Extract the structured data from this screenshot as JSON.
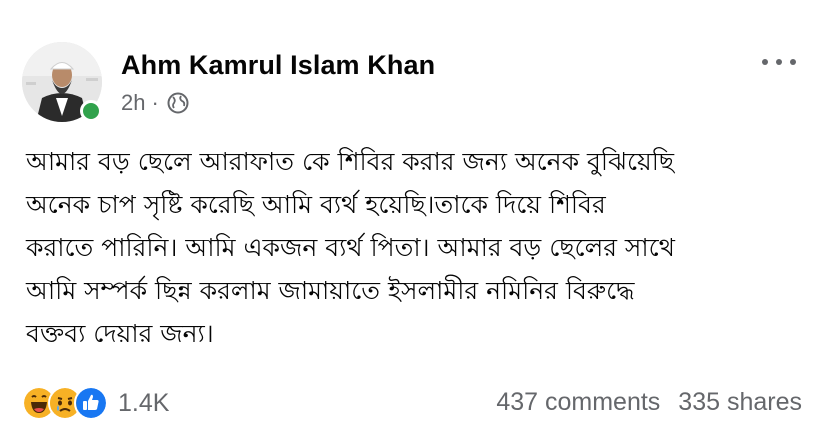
{
  "post": {
    "author": "Ahm Kamrul Islam Khan",
    "time": "2h",
    "separator": "·",
    "privacy_icon": "globe-icon",
    "more_icon": "ellipsis-icon",
    "text_lines": [
      "আমার বড় ছেলে আরাফাত কে শিবির করার জন্য অনেক বুঝিয়েছি",
      "অনেক চাপ সৃষ্টি করেছি আমি ব্যর্থ হয়েছি।তাকে দিয়ে শিবির",
      "করাতে পারিনি। আমি একজন ব্যর্থ পিতা। আমার বড় ছেলের সাথে",
      "আমি সম্পর্ক ছিন্ন করলাম জামায়াতে ইসলামীর নমিনির বিরুদ্ধে",
      "বক্তব্য দেয়ার জন্য।"
    ]
  },
  "footer": {
    "reaction_icons": [
      "haha-icon",
      "sad-icon",
      "like-icon"
    ],
    "reaction_count": "1.4K",
    "comments": "437 comments",
    "shares": "335 shares"
  },
  "colors": {
    "text": "#050505",
    "secondary": "#65676b",
    "online": "#31a24c",
    "like_blue": "#1877f2",
    "emoji_yellow": "#f7b125"
  }
}
